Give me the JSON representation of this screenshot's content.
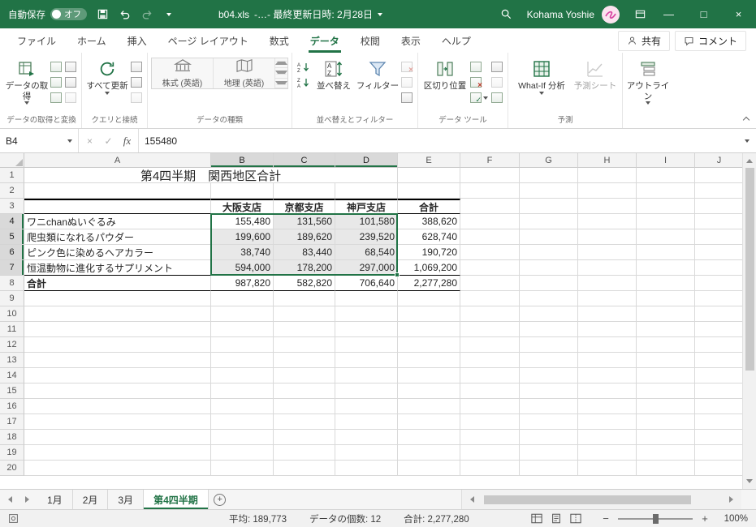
{
  "title_bar": {
    "autosave_label": "自動保存",
    "autosave_state": "オフ",
    "filename": "b04.xls",
    "title_suffix": "-…-  最終更新日時: 2月28日",
    "user_name": "Kohama Yoshie"
  },
  "ribbon_tabs": {
    "items": [
      {
        "label": "ファイル"
      },
      {
        "label": "ホーム"
      },
      {
        "label": "挿入"
      },
      {
        "label": "ページ レイアウト"
      },
      {
        "label": "数式"
      },
      {
        "label": "データ"
      },
      {
        "label": "校閲"
      },
      {
        "label": "表示"
      },
      {
        "label": "ヘルプ"
      }
    ],
    "share_label": "共有",
    "comments_label": "コメント"
  },
  "ribbon": {
    "get_data_label": "データの取得",
    "refresh_all_label": "すべて更新",
    "stocks_label": "株式 (英語)",
    "geography_label": "地理 (英語)",
    "sort_label": "並べ替え",
    "filter_label": "フィルター",
    "text_to_columns_label": "区切り位置",
    "what_if_label": "What-If 分析",
    "forecast_sheet_label": "予測シート",
    "outline_label": "アウトライン",
    "group_labels": {
      "get_transform": "データの取得と変換",
      "queries": "クエリと接続",
      "data_types": "データの種類",
      "sort_filter": "並べ替えとフィルター",
      "data_tools": "データ ツール",
      "forecast": "予測"
    }
  },
  "formula_bar": {
    "name_box": "B4",
    "fx_label": "fx",
    "value": "155480"
  },
  "sheet": {
    "columns": [
      "A",
      "B",
      "C",
      "D",
      "E",
      "F",
      "G",
      "H",
      "I",
      "J"
    ],
    "visible_rows": 20,
    "title_cell": {
      "row": 1,
      "text": "第4四半期　関西地区合計"
    },
    "header_row": {
      "row": 3,
      "labels": [
        "大阪支店",
        "京都支店",
        "神戸支店",
        "合計"
      ]
    },
    "data_rows": [
      {
        "row": 4,
        "label": "ワニchanぬいぐるみ",
        "values": [
          "155,480",
          "131,560",
          "101,580",
          "388,620"
        ]
      },
      {
        "row": 5,
        "label": "爬虫類になれるパウダー",
        "values": [
          "199,600",
          "189,620",
          "239,520",
          "628,740"
        ]
      },
      {
        "row": 6,
        "label": "ピンク色に染めるヘアカラー",
        "values": [
          "38,740",
          "83,440",
          "68,540",
          "190,720"
        ]
      },
      {
        "row": 7,
        "label": "恒温動物に進化するサプリメント",
        "values": [
          "594,000",
          "178,200",
          "297,000",
          "1,069,200"
        ]
      }
    ],
    "total_row": {
      "row": 8,
      "label": "合計",
      "values": [
        "987,820",
        "582,820",
        "706,640",
        "2,277,280"
      ]
    },
    "selection": {
      "range": "B4:D7",
      "active_cell": "B4"
    }
  },
  "sheet_tabs": {
    "items": [
      {
        "label": "1月"
      },
      {
        "label": "2月"
      },
      {
        "label": "3月"
      },
      {
        "label": "第4四半期"
      }
    ]
  },
  "status_bar": {
    "average": "平均: 189,773",
    "count": "データの個数: 12",
    "sum": "合計: 2,277,280",
    "zoom": "100%"
  }
}
